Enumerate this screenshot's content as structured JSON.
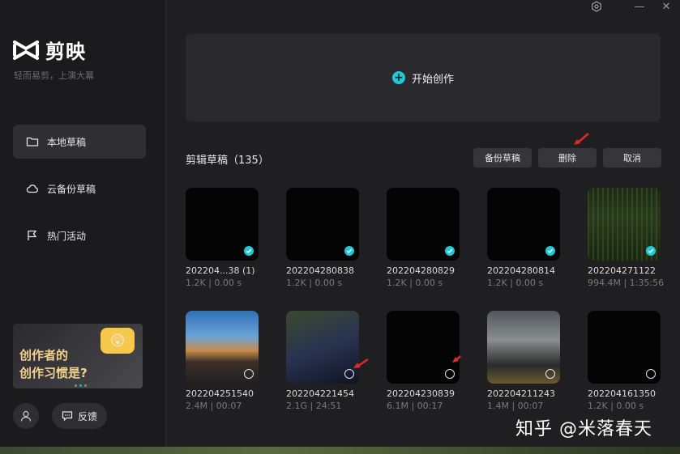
{
  "app": {
    "name": "剪映",
    "slogan": "轻而易剪，上演大幕"
  },
  "colors": {
    "accent": "#1fc9d6",
    "background": "#1f1f22",
    "sidebar": "#1b1b1e",
    "arrow": "#e02a2a"
  },
  "window_controls": {
    "settings_icon": "gear-icon",
    "minimize": "—",
    "close": "✕"
  },
  "sidebar": {
    "items": [
      {
        "label": "本地草稿",
        "icon": "folder-icon",
        "active": true
      },
      {
        "label": "云备份草稿",
        "icon": "cloud-icon",
        "active": false
      },
      {
        "label": "热门活动",
        "icon": "flag-icon",
        "active": false
      }
    ],
    "promo": {
      "line1": "创作者的",
      "line2": "创作习惯是?"
    },
    "feedback_label": "反馈"
  },
  "main": {
    "create_label": "开始创作",
    "section_title": "剪辑草稿（135）",
    "buttons": {
      "backup": "备份草稿",
      "delete": "删除",
      "cancel": "取消"
    },
    "drafts": [
      {
        "name": "202204...38 (1)",
        "meta": "1.2K | 0.00 s",
        "selected": true,
        "art": "black"
      },
      {
        "name": "202204280838",
        "meta": "1.2K | 0.00 s",
        "selected": true,
        "art": "black"
      },
      {
        "name": "202204280829",
        "meta": "1.2K | 0.00 s",
        "selected": true,
        "art": "black"
      },
      {
        "name": "202204280814",
        "meta": "1.2K | 0.00 s",
        "selected": true,
        "art": "black"
      },
      {
        "name": "202204271122",
        "meta": "994.4M | 1:35:56",
        "selected": true,
        "art": "grass"
      },
      {
        "name": "202204251540",
        "meta": "2.4M | 00:07",
        "selected": false,
        "art": "lake"
      },
      {
        "name": "202204221454",
        "meta": "2.1G | 24:51",
        "selected": false,
        "art": "game"
      },
      {
        "name": "202204230839",
        "meta": "6.1M | 00:17",
        "selected": false,
        "art": "black"
      },
      {
        "name": "202204211243",
        "meta": "1.4M | 00:07",
        "selected": false,
        "art": "photo"
      },
      {
        "name": "202204161350",
        "meta": "1.2K | 0.00 s",
        "selected": false,
        "art": "black"
      }
    ]
  },
  "watermark": "知乎 @米落春天"
}
